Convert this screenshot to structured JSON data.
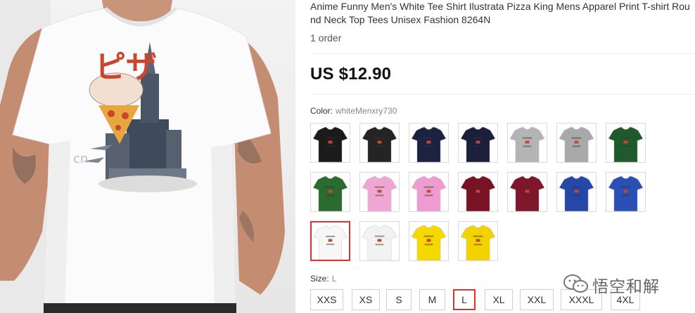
{
  "product": {
    "title": "Anime Funny Men's White Tee Shirt Ilustrata Pizza King Mens Apparel Print T-shirt Round Neck Top Tees Unisex Fashion 8264N",
    "orders": "1 order",
    "price": "US $12.90",
    "image": {
      "print_text": "ピザ",
      "print_caption": "cn",
      "shirt_color": "#ffffff"
    }
  },
  "color_picker": {
    "label": "Color:",
    "selected_value": "whiteMenxry730",
    "swatches": [
      {
        "name": "black",
        "color": "#1b1b1b",
        "selected": false
      },
      {
        "name": "black-2",
        "color": "#242424",
        "selected": false
      },
      {
        "name": "navy",
        "color": "#1c2340",
        "selected": false
      },
      {
        "name": "navy-2",
        "color": "#1a1f3b",
        "selected": false
      },
      {
        "name": "light-gray",
        "color": "#b4b4b4",
        "selected": false
      },
      {
        "name": "gray",
        "color": "#a9a9a9",
        "selected": false
      },
      {
        "name": "forest-green",
        "color": "#1f5a2c",
        "selected": false
      },
      {
        "name": "green",
        "color": "#2a6b30",
        "selected": false
      },
      {
        "name": "pink",
        "color": "#f0a6d2",
        "selected": false
      },
      {
        "name": "pink-2",
        "color": "#ee9bd0",
        "selected": false
      },
      {
        "name": "maroon",
        "color": "#7a1225",
        "selected": false
      },
      {
        "name": "maroon-2",
        "color": "#801629",
        "selected": false
      },
      {
        "name": "royal-blue",
        "color": "#2548a8",
        "selected": false
      },
      {
        "name": "royal-blue-2",
        "color": "#2a4fb5",
        "selected": false
      },
      {
        "name": "white",
        "color": "#f7f7f7",
        "selected": true
      },
      {
        "name": "white-2",
        "color": "#f2f2f2",
        "selected": false
      },
      {
        "name": "yellow",
        "color": "#f5d800",
        "selected": false
      },
      {
        "name": "yellow-2",
        "color": "#f2d200",
        "selected": false
      }
    ]
  },
  "size_picker": {
    "label": "Size:",
    "selected_value": "L",
    "options": [
      {
        "label": "XXS",
        "selected": false
      },
      {
        "label": "XS",
        "selected": false
      },
      {
        "label": "S",
        "selected": false
      },
      {
        "label": "M",
        "selected": false
      },
      {
        "label": "L",
        "selected": true
      },
      {
        "label": "XL",
        "selected": false
      },
      {
        "label": "XXL",
        "selected": false
      },
      {
        "label": "XXXL",
        "selected": false
      },
      {
        "label": "4XL",
        "selected": false
      }
    ]
  },
  "watermark": {
    "text": "悟空和解",
    "icon": "wechat-icon"
  },
  "theme": {
    "accent": "#e62e2e",
    "print_red": "#c8452e"
  }
}
